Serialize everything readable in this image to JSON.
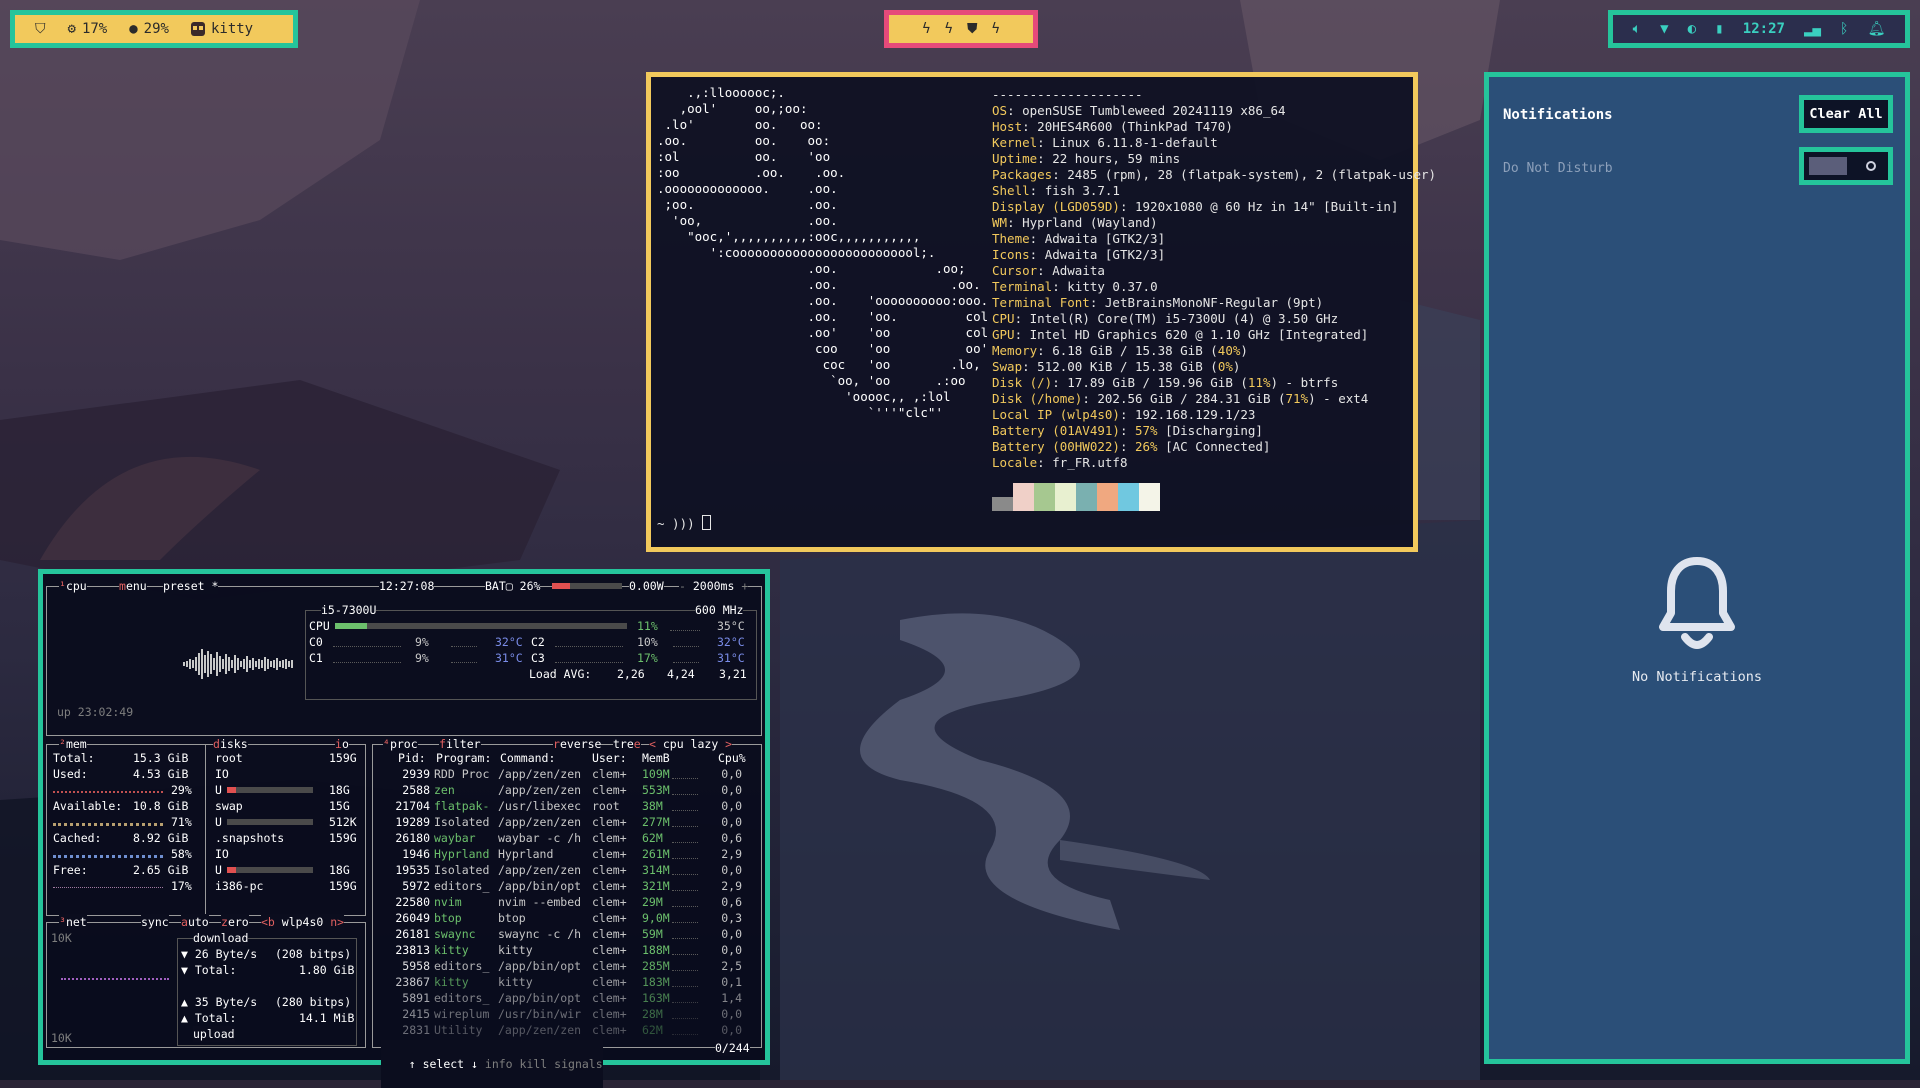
{
  "topbar_left": {
    "cpu": "17%",
    "memory": "29%",
    "active_window": "kitty"
  },
  "topbar_center": {
    "workspace_icons": [
      "ϟ",
      "ϟ",
      "⛊",
      "ϟ"
    ]
  },
  "topbar_right": {
    "clock": "12:27"
  },
  "terminal": {
    "logo": [
      "    .,:lloooooc;.",
      "   ,ool'     oo,;oo:",
      " .lo'        oo.   oo:",
      ".oo.         oo.    oo:",
      ":ol          oo.    'oo",
      ":oo          .oo.    .oo.",
      ".ooooooooooooo.     .oo.",
      " ;oo.               .oo.",
      "  'oo,              .oo.",
      "    \"ooc,',,,,,,,,,,:ooc,,,,,,,,,,,",
      "       ':cooooooooooooooooooooooool;.",
      "                    .oo.             .oo;",
      "                    .oo.               .oo.",
      "                    .oo.    'oooooooooo:ooo.",
      "                    .oo.    'oo.         col",
      "                    .oo'    'oo          col",
      "                     coo    'oo          oo'",
      "                      coc   'oo        .lo,",
      "                       `oo, 'oo      .:oo",
      "                         'ooooc,, ,:lol",
      "                            `'''\"clc\"'"
    ],
    "separator": "--------------------",
    "info": [
      {
        "key": "OS",
        "value": "openSUSE Tumbleweed 20241119 x86_64"
      },
      {
        "key": "Host",
        "value": "20HES4R600 (ThinkPad T470)"
      },
      {
        "key": "Kernel",
        "value": "Linux 6.11.8-1-default"
      },
      {
        "key": "Uptime",
        "value": "22 hours, 59 mins"
      },
      {
        "key": "Packages",
        "value": "2485 (rpm), 28 (flatpak-system), 2 (flatpak-user)"
      },
      {
        "key": "Shell",
        "value": "fish 3.7.1"
      },
      {
        "key": "Display (LGD059D)",
        "value": "1920x1080 @ 60 Hz in 14\" [Built-in]"
      },
      {
        "key": "WM",
        "value": "Hyprland (Wayland)"
      },
      {
        "key": "Theme",
        "value": "Adwaita [GTK2/3]"
      },
      {
        "key": "Icons",
        "value": "Adwaita [GTK2/3]"
      },
      {
        "key": "Cursor",
        "value": "Adwaita"
      },
      {
        "key": "Terminal",
        "value": "kitty 0.37.0"
      },
      {
        "key": "Terminal Font",
        "value": "JetBrainsMonoNF-Regular (9pt)"
      },
      {
        "key": "CPU",
        "value": "Intel(R) Core(TM) i5-7300U (4) @ 3.50 GHz"
      },
      {
        "key": "GPU",
        "value": "Intel HD Graphics 620 @ 1.10 GHz [Integrated]"
      },
      {
        "key": "Memory",
        "value": "6.18 GiB / 15.38 GiB",
        "pct": "(40%)",
        "tail": ""
      },
      {
        "key": "Swap",
        "value": "512.00 KiB / 15.38 GiB",
        "pct": "(0%)",
        "tail": ""
      },
      {
        "key": "Disk (/)",
        "value": "17.89 GiB / 159.96 GiB",
        "pct": "(11%)",
        "tail": " - btrfs"
      },
      {
        "key": "Disk (/home)",
        "value": "202.56 GiB / 284.31 GiB",
        "pct": "(71%)",
        "tail": " - ext4"
      },
      {
        "key": "Local IP (wlp4s0)",
        "value": "192.168.129.1/23"
      },
      {
        "key": "Battery (01AV491)",
        "value": "",
        "pct": "57%",
        "tail": " [Discharging]"
      },
      {
        "key": "Battery (00HW022)",
        "value": "",
        "pct": "26%",
        "tail": " [AC Connected]"
      },
      {
        "key": "Locale",
        "value": "fr_FR.utf8"
      }
    ],
    "palette": [
      "#8a8a8a",
      "#f0d0c8",
      "#a6c890",
      "#e8f0d0",
      "#7ab0b0",
      "#f0a880",
      "#70c8e0",
      "#f4f4e8"
    ],
    "prompt": "~ ))) "
  },
  "notifications": {
    "title": "Notifications",
    "clear_all": "Clear All",
    "dnd_label": "Do Not Disturb",
    "dnd_enabled": false,
    "empty_text": "No Notifications"
  },
  "btop": {
    "header": {
      "cpu_tab": "cpu",
      "menu": "menu",
      "preset": "preset *",
      "time": "12:27:08",
      "battery_label": "BAT",
      "battery_pct": "26%",
      "battery_fill": 0.26,
      "power": "0.00W",
      "refresh": "2000ms"
    },
    "cpu": {
      "model": "i5-7300U",
      "freq": "600 MHz",
      "total_pct": "11%",
      "total_fill": 0.11,
      "total_temp": "35°C",
      "cores": [
        {
          "name": "C0",
          "pct": "9%",
          "temp": "32°C"
        },
        {
          "name": "C2",
          "pct": "10%",
          "temp": "32°C"
        },
        {
          "name": "C1",
          "pct": "9%",
          "temp": "31°C"
        },
        {
          "name": "C3",
          "pct": "17%",
          "temp": "31°C"
        }
      ],
      "load_label": "Load AVG:",
      "load": [
        "2,26",
        "4,24",
        "3,21"
      ],
      "uptime": "up 23:02:49"
    },
    "mem": {
      "title": "mem",
      "total_label": "Total:",
      "total": "15.3 GiB",
      "used_label": "Used:",
      "used": "4.53 GiB",
      "used_pct": "29%",
      "avail_label": "Available:",
      "avail": "10.8 GiB",
      "avail_pct": "71%",
      "cached_label": "Cached:",
      "cached": "8.92 GiB",
      "cached_pct": "58%",
      "free_label": "Free:",
      "free": "2.65 GiB",
      "free_pct": "17%"
    },
    "disks": {
      "title": "disks",
      "io_tab": "io",
      "items": [
        {
          "name": "root",
          "size": "159G",
          "io": "IO",
          "used": "18G",
          "fill": 0.11
        },
        {
          "name": "swap",
          "size": "15G",
          "io": "",
          "used": "512K",
          "fill": 0.0
        },
        {
          "name": ".snapshots",
          "size": "159G",
          "io": "IO",
          "used": "18G",
          "fill": 0.11
        },
        {
          "name": "i386-pc",
          "size": "159G",
          "io": "",
          "used": "",
          "fill": 0
        }
      ]
    },
    "net": {
      "title": "net",
      "sync": "sync",
      "auto": "auto",
      "zero": "zero",
      "iface": "wlp4s0",
      "scale_top": "10K",
      "scale_bottom": "10K",
      "download_label": "download",
      "down_rate": "26 Byte/s",
      "down_bits": "(208 bitps)",
      "down_total_label": "Total:",
      "down_total": "1.80 GiB",
      "up_rate": "35 Byte/s",
      "up_bits": "(280 bitps)",
      "up_total_label": "Total:",
      "up_total": "14.1 MiB",
      "upload_label": "upload"
    },
    "proc": {
      "title": "proc",
      "filter": "filter",
      "reverse": "reverse",
      "tree": "tree",
      "sort": "cpu lazy",
      "headers": [
        "Pid:",
        "Program:",
        "Command:",
        "User:",
        "MemB",
        "Cpu%"
      ],
      "rows": [
        [
          "2939",
          "RDD Proc",
          "/app/zen/zen",
          "clem+",
          "109M",
          "0,0"
        ],
        [
          "2588",
          "zen",
          "/app/zen/zen",
          "clem+",
          "553M",
          "0,0"
        ],
        [
          "21704",
          "flatpak-",
          "/usr/libexec",
          "root",
          "38M",
          "0,0"
        ],
        [
          "19289",
          "Isolated",
          "/app/zen/zen",
          "clem+",
          "277M",
          "0,0"
        ],
        [
          "26180",
          "waybar",
          "waybar -c /h",
          "clem+",
          "62M",
          "0,6"
        ],
        [
          "1946",
          "Hyprland",
          "Hyprland",
          "clem+",
          "261M",
          "2,9"
        ],
        [
          "19535",
          "Isolated",
          "/app/zen/zen",
          "clem+",
          "314M",
          "0,0"
        ],
        [
          "5972",
          "editors_",
          "/app/bin/opt",
          "clem+",
          "321M",
          "2,9"
        ],
        [
          "22580",
          "nvim",
          "nvim --embed",
          "clem+",
          "29M",
          "0,6"
        ],
        [
          "26049",
          "btop",
          "btop",
          "clem+",
          "9,0M",
          "0,3"
        ],
        [
          "26181",
          "swaync",
          "swaync -c /h",
          "clem+",
          "59M",
          "0,0"
        ],
        [
          "23813",
          "kitty",
          "kitty",
          "clem+",
          "188M",
          "0,0"
        ],
        [
          "5958",
          "editors_",
          "/app/bin/opt",
          "clem+",
          "285M",
          "2,5"
        ],
        [
          "23867",
          "kitty",
          "kitty",
          "clem+",
          "183M",
          "0,1"
        ],
        [
          "5891",
          "editors_",
          "/app/bin/opt",
          "clem+",
          "163M",
          "1,4"
        ],
        [
          "2415",
          "wireplum",
          "/usr/bin/wir",
          "clem+",
          "28M",
          "0,0"
        ],
        [
          "2831",
          "Utility",
          "/app/zen/zen",
          "clem+",
          "62M",
          "0,0"
        ]
      ],
      "footer_select": "select",
      "footer_info": "info",
      "footer_kill": "kill",
      "footer_signals": "signals",
      "count": "0/244"
    }
  },
  "colors": {
    "accent_teal": "#25c49b",
    "accent_yellow": "#f2c95c",
    "accent_pink": "#e64a7a",
    "panel_blue": "#2b4f78"
  }
}
